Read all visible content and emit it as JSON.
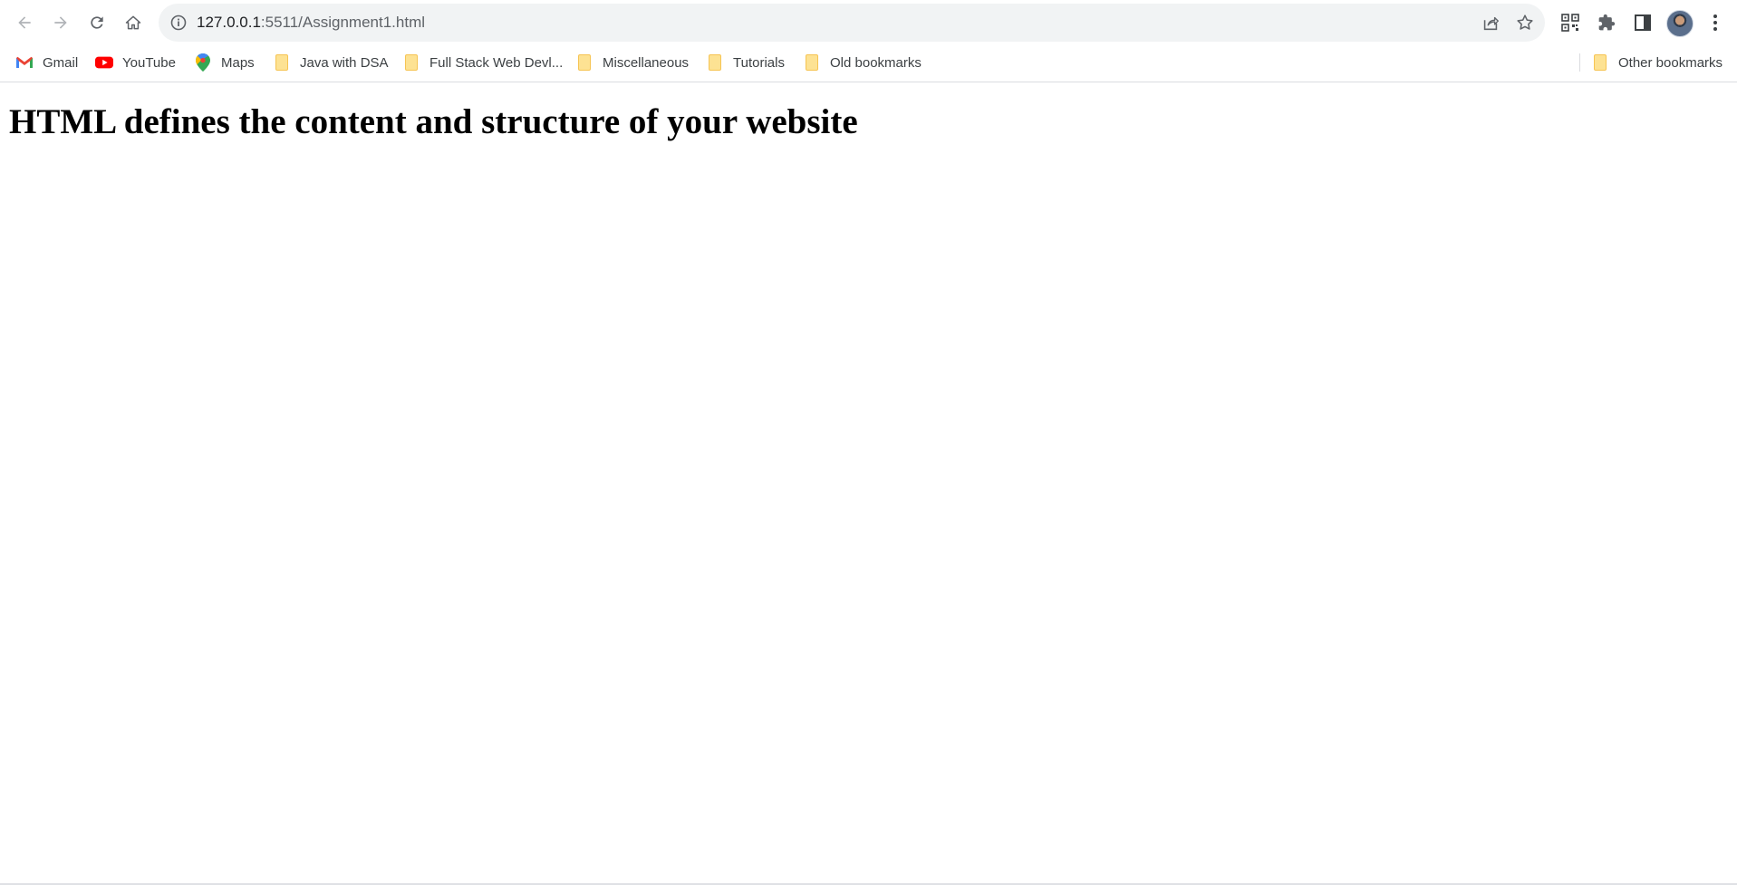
{
  "browser": {
    "url_host": "127.0.0.1",
    "url_rest": ":5511/Assignment1.html"
  },
  "bookmarks": [
    {
      "label": "Gmail",
      "icon": "gmail-icon"
    },
    {
      "label": "YouTube",
      "icon": "youtube-icon"
    },
    {
      "label": "Maps",
      "icon": "maps-icon"
    },
    {
      "label": "Java with DSA",
      "icon": "folder-icon"
    },
    {
      "label": "Full Stack Web Devl...",
      "icon": "folder-icon"
    },
    {
      "label": "Miscellaneous",
      "icon": "folder-icon"
    },
    {
      "label": "Tutorials",
      "icon": "folder-icon"
    },
    {
      "label": "Old bookmarks",
      "icon": "folder-icon"
    }
  ],
  "other_bookmarks": {
    "label": "Other bookmarks",
    "icon": "folder-icon"
  },
  "page": {
    "heading": "HTML defines the content and structure of your website"
  },
  "colors": {
    "toolbar_bg": "#ffffff",
    "omnibox_bg": "#f1f3f4",
    "folder": "#fde293",
    "youtube_red": "#ff0000"
  }
}
